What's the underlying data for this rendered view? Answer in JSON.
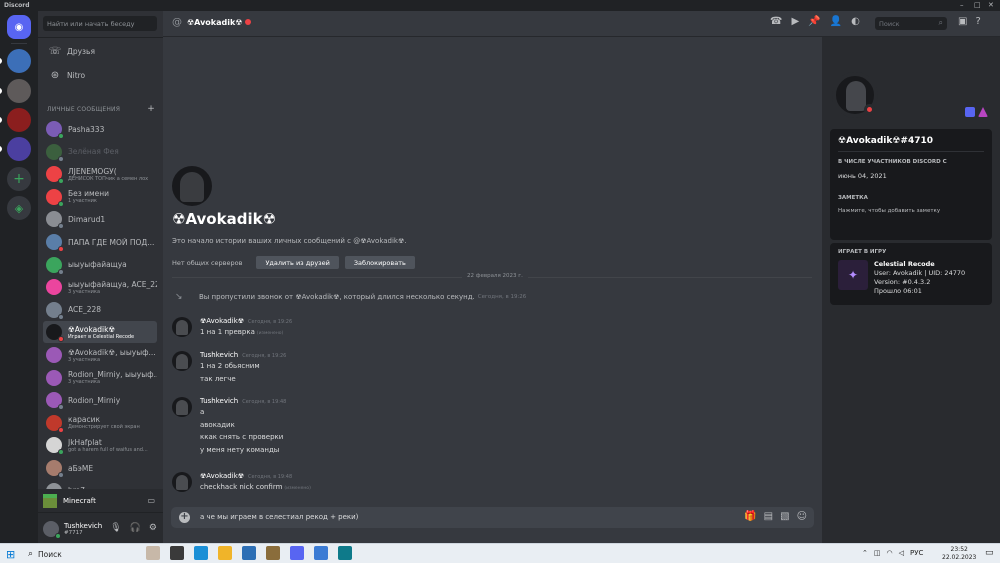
{
  "window": {
    "title": "Discord"
  },
  "sidebar": {
    "search_placeholder": "Найти или начать беседу",
    "nav": [
      {
        "label": "Друзья"
      },
      {
        "label": "Nitro"
      }
    ],
    "dm_header": "ЛИЧНЫЕ СООБЩЕНИЯ",
    "dms": [
      {
        "name": "Pasha333",
        "sub": "",
        "color": "#7b5cb5"
      },
      {
        "name": "Зелёная Фея",
        "sub": "",
        "color": "#3b5f3e"
      },
      {
        "name": "ЛЈЕNЕМОGУ(",
        "sub": "ДЕНИСОК ТОПчик а семен лох",
        "color": "#ed4245"
      },
      {
        "name": "Без имени",
        "sub": "1 участник",
        "color": "#ed4245"
      },
      {
        "name": "Dimarud1",
        "sub": "",
        "color": "#8a8d93"
      },
      {
        "name": "ПАПА ГДЕ МОЙ ПОД...",
        "sub": "",
        "color": "#5a7ea8"
      },
      {
        "name": "ыыуыфайащуа",
        "sub": "",
        "color": "#3ba55d"
      },
      {
        "name": "ыыуыфайащуа, ACE_228",
        "sub": "3 участника",
        "color": "#eb459e"
      },
      {
        "name": "ACE_228",
        "sub": "",
        "color": "#747f8d"
      },
      {
        "name": "☢Avokadik☢",
        "sub": "Играет в Celestial Recode",
        "color": "#18191c"
      },
      {
        "name": "☢Avokadik☢, ыыуыф...",
        "sub": "3 участника",
        "color": "#9b59b6"
      },
      {
        "name": "Rodion_Mirniy, ыыуыф...",
        "sub": "3 участника",
        "color": "#9b59b6"
      },
      {
        "name": "Rodion_Mirniy",
        "sub": "",
        "color": "#9b59b6"
      },
      {
        "name": "карасик",
        "sub": "Демонстрирует свой экран",
        "color": "#c0392b"
      },
      {
        "name": "JkHafplat",
        "sub": "got a harem full of waifus and...",
        "color": "#d5d5d5"
      },
      {
        "name": "аБэМЕ",
        "sub": "",
        "color": "#a67c6d"
      },
      {
        "name": "bro7",
        "sub": "",
        "color": "#8e9297"
      }
    ],
    "activity": "Minecraft",
    "user": {
      "name": "Tushkevich",
      "tag": "#7717"
    }
  },
  "header": {
    "name": "☢Avokadik☢",
    "search_placeholder": "Поиск"
  },
  "intro": {
    "name": "☢Avokadik☢",
    "text": "Это начало истории ваших личных сообщений с @☢Avokadik☢.",
    "no_common": "Нет общих серверов",
    "remove_friend": "Удалить из друзей",
    "block": "Заблокировать"
  },
  "date_divider": "22 февраля 2023 г.",
  "missed_call": {
    "text": "Вы пропустили звонок от ☢Avokadik☢, который длился несколько секунд.",
    "time": "Сегодня, в 19:26"
  },
  "messages": [
    {
      "author": "☢Avokadik☢",
      "time": "Сегодня, в 19:26",
      "lines": [
        "1 на 1 преврка"
      ],
      "edited": "(изменено)"
    },
    {
      "author": "Tushkevich",
      "time": "Сегодня, в 19:26",
      "lines": [
        "1 на 2 обьясним",
        "так легче"
      ],
      "edited": ""
    },
    {
      "author": "Tushkevich",
      "time": "Сегодня, в 19:48",
      "lines": [
        "а",
        "авокадик",
        "ккак снять с проверки",
        "у меня нету команды"
      ],
      "edited": ""
    },
    {
      "author": "☢Avokadik☢",
      "time": "Сегодня, в 19:48",
      "lines": [
        "checkhack nick confirm"
      ],
      "edited": "(изменено)"
    }
  ],
  "composer": {
    "value": "а че мы играем в селестиал рекод + реки)"
  },
  "profile": {
    "username": "☢Avokadik☢#4710",
    "member_since_label": "В ЧИСЛЕ УЧАСТНИКОВ DISCORD С",
    "member_since": "июнь 04, 2021",
    "note_label": "ЗАМЕТКА",
    "note_placeholder": "Нажмите, чтобы добавить заметку",
    "playing_label": "ИГРАЕТ В ИГРУ",
    "game": {
      "title": "Celestial Recode",
      "line1": "User: Avokadik | UID: 24770",
      "line2": "Version: #0.4.3.2",
      "line3": "Прошло 06:01"
    }
  },
  "taskbar": {
    "search": "Поиск",
    "lang": "РУС",
    "time": "23:52",
    "date": "22.02.2023"
  }
}
